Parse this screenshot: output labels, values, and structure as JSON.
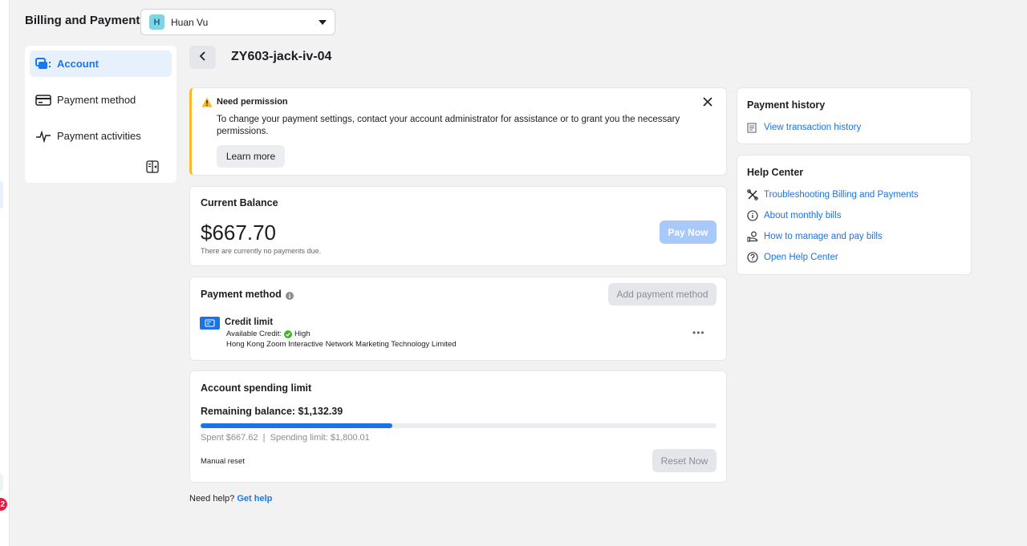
{
  "header": {
    "title": "Billing and Payment",
    "account": {
      "initial": "H",
      "name": "Huan Vu"
    }
  },
  "sidebar": {
    "items": [
      {
        "label": "Account",
        "icon": "account-icon",
        "active": true
      },
      {
        "label": "Payment method",
        "icon": "credit-card-icon",
        "active": false
      },
      {
        "label": "Payment activities",
        "icon": "pulse-icon",
        "active": false
      }
    ]
  },
  "edge": {
    "notification_count": "2"
  },
  "main": {
    "ad_account_title": "ZY603-jack-iv-04",
    "notice": {
      "heading": "Need permission",
      "message": "To change your payment settings, contact your account administrator for assistance or to grant you the necessary permissions.",
      "learn_more": "Learn more"
    },
    "balance": {
      "heading": "Current Balance",
      "amount": "$667.70",
      "subtext": "There are currently no payments due.",
      "pay_now": "Pay Now"
    },
    "payment_method": {
      "heading": "Payment method",
      "add_button": "Add payment method",
      "credit_title": "Credit limit",
      "credit_label": "Available Credit:",
      "credit_value": "High",
      "company": "Hong Kong Zoom Interactive Network Marketing Technology Limited"
    },
    "spending_limit": {
      "heading": "Account spending limit",
      "remaining": "Remaining balance: $1,132.39",
      "spent_text": "Spent $667.62  |  Spending limit: $1,800.01",
      "progress_fraction": 0.371,
      "reset_label": "Manual reset",
      "reset_button": "Reset Now"
    },
    "need_help": {
      "text": "Need help?",
      "link": "Get help"
    }
  },
  "right": {
    "history": {
      "heading": "Payment history",
      "link": "View transaction history"
    },
    "help_center": {
      "heading": "Help Center",
      "links": [
        {
          "label": "Troubleshooting Billing and Payments",
          "icon": "tools-icon"
        },
        {
          "label": "About monthly bills",
          "icon": "info-icon"
        },
        {
          "label": "How to manage and pay bills",
          "icon": "hand-coin-icon"
        },
        {
          "label": "Open Help Center",
          "icon": "question-icon"
        }
      ]
    }
  },
  "colors": {
    "accent": "#1877f2",
    "warning": "#f7b928",
    "success": "#42b72a"
  }
}
